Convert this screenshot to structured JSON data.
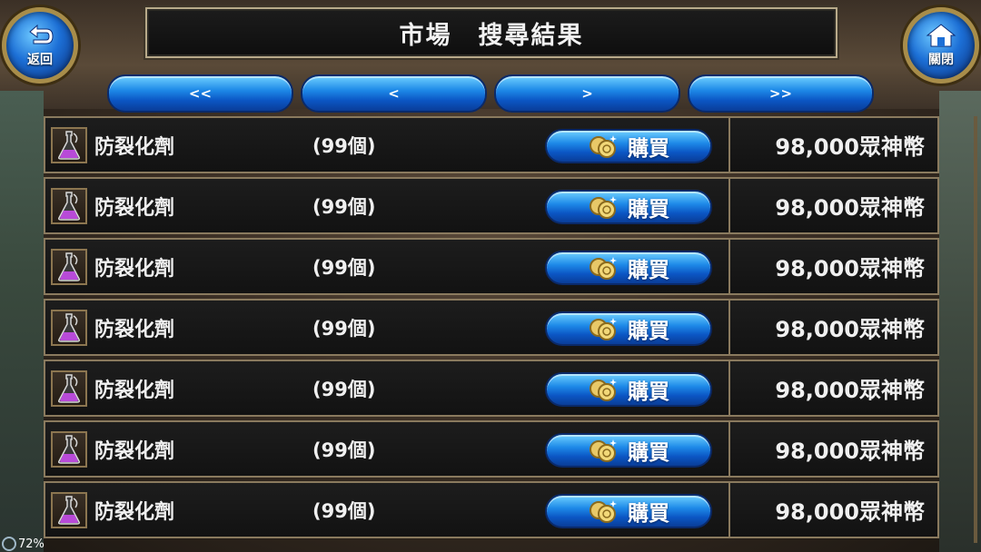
{
  "header": {
    "title": "市場　搜尋結果",
    "back_label": "返回",
    "close_label": "關閉"
  },
  "pager": {
    "first": "<<",
    "prev": "<",
    "next": ">",
    "last": ">>"
  },
  "rows": [
    {
      "name": "防裂化劑",
      "qty": "(99個)",
      "buy": "購買",
      "price": "98,000眾神幣"
    },
    {
      "name": "防裂化劑",
      "qty": "(99個)",
      "buy": "購買",
      "price": "98,000眾神幣"
    },
    {
      "name": "防裂化劑",
      "qty": "(99個)",
      "buy": "購買",
      "price": "98,000眾神幣"
    },
    {
      "name": "防裂化劑",
      "qty": "(99個)",
      "buy": "購買",
      "price": "98,000眾神幣"
    },
    {
      "name": "防裂化劑",
      "qty": "(99個)",
      "buy": "購買",
      "price": "98,000眾神幣"
    },
    {
      "name": "防裂化劑",
      "qty": "(99個)",
      "buy": "購買",
      "price": "98,000眾神幣"
    },
    {
      "name": "防裂化劑",
      "qty": "(99個)",
      "buy": "購買",
      "price": "98,000眾神幣"
    }
  ],
  "status": {
    "loading_pct": "72%"
  },
  "icons": {
    "back": "return-arrow-icon",
    "close": "home-icon",
    "item": "potion-flask-icon",
    "coin": "coin-icon"
  },
  "colors": {
    "button_blue": "#1e8ae8",
    "frame_gold": "#a88d4a",
    "potion_purple": "#b84ad8"
  }
}
